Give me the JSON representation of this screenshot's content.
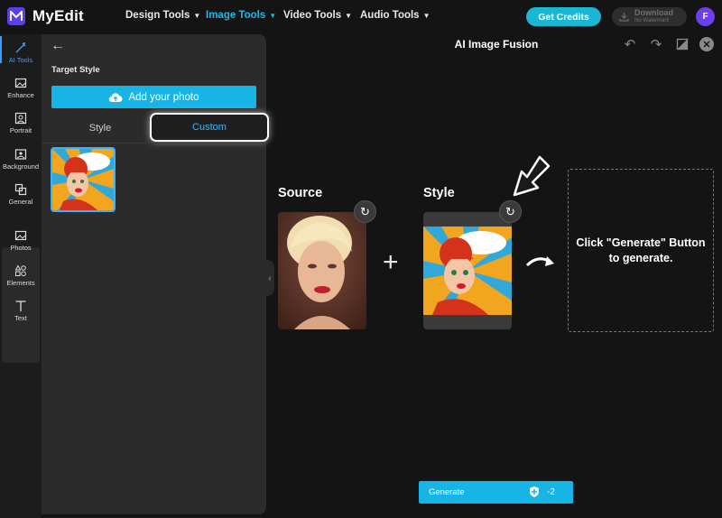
{
  "app": {
    "name": "MyEdit",
    "logo_letter": "M"
  },
  "nav": [
    {
      "label": "Design Tools",
      "active": false
    },
    {
      "label": "Image Tools",
      "active": true
    },
    {
      "label": "Video Tools",
      "active": false
    },
    {
      "label": "Audio Tools",
      "active": false
    }
  ],
  "header": {
    "credits_label": "Get Credits",
    "download_label": "Download",
    "download_sub": "No Watermark",
    "avatar_initial": "F"
  },
  "rail": {
    "items": [
      {
        "label": "AI Tools",
        "icon": "magic-wand-icon",
        "active": true
      },
      {
        "label": "Enhance",
        "icon": "enhance-icon"
      },
      {
        "label": "Portrait",
        "icon": "portrait-icon"
      },
      {
        "label": "Background",
        "icon": "background-icon"
      },
      {
        "label": "General",
        "icon": "general-icon"
      },
      {
        "label": "Photos",
        "icon": "photos-icon"
      },
      {
        "label": "Elements",
        "icon": "elements-icon"
      },
      {
        "label": "Text",
        "icon": "text-icon"
      }
    ]
  },
  "panel": {
    "section_label": "Target Style",
    "add_photo_label": "Add your photo",
    "tabs": {
      "style": "Style",
      "custom": "Custom"
    }
  },
  "main": {
    "title": "AI Image Fusion",
    "source_heading": "Source",
    "style_heading": "Style",
    "result_text": "Click \"Generate\" Button to generate.",
    "generate_label": "Generate",
    "generate_credits": "-2"
  },
  "colors": {
    "accent": "#17b5e6",
    "brand": "#5b3df5",
    "active_nav": "#21b8e6"
  }
}
